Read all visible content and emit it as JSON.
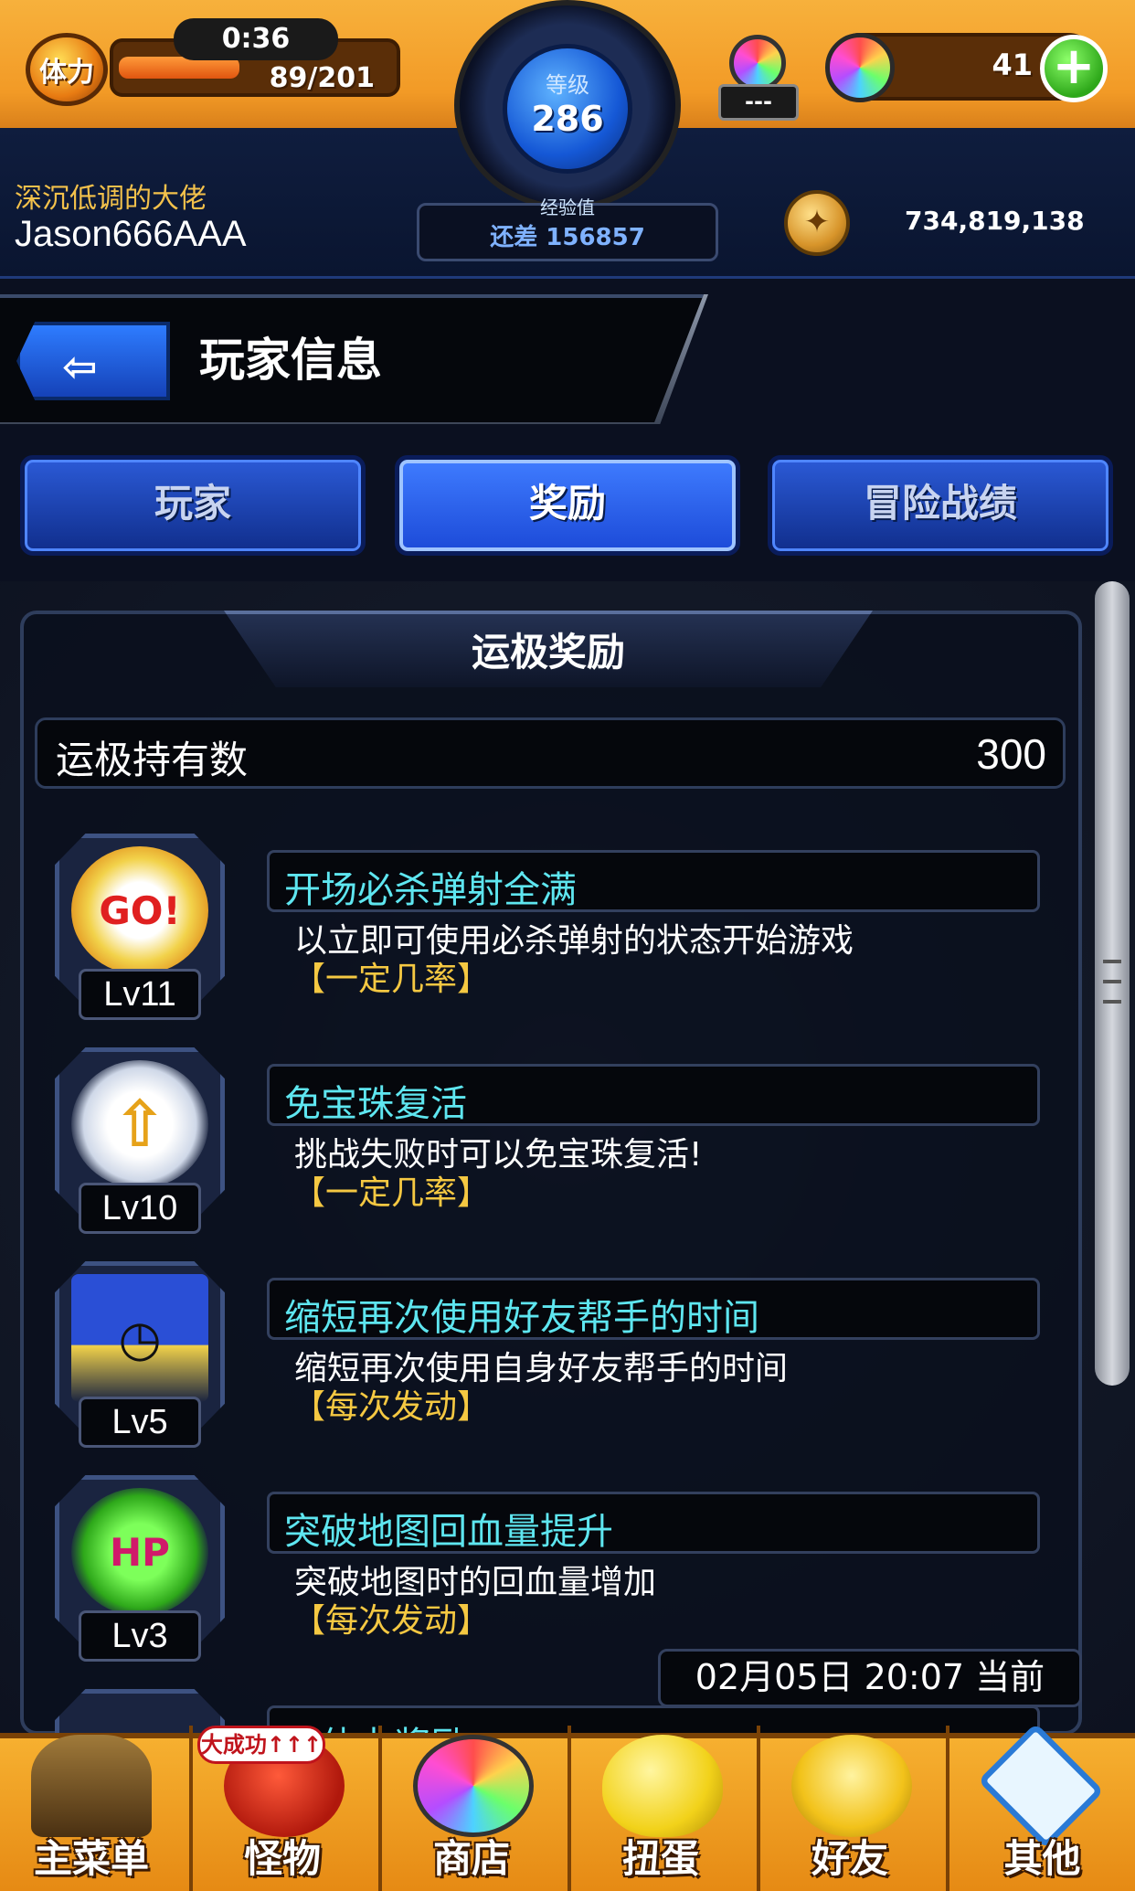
{
  "hud": {
    "stamina_label": "体力",
    "stamina_timer": "0:36",
    "stamina_value": "89/201",
    "stamina_fraction": 0.44,
    "level_label": "等级",
    "level_value": "286",
    "exp_label": "经验值",
    "exp_prefix": "还差",
    "exp_remaining": "156857",
    "gem_cap_count": "---",
    "gem_count": "41",
    "gem_plus": "+",
    "coin_value": "734,819,138"
  },
  "player": {
    "title": "深沉低调的大佬",
    "name": "Jason666AAA"
  },
  "header": {
    "title": "玩家信息",
    "back_icon": "back-arrow-icon"
  },
  "tabs": [
    {
      "label": "玩家",
      "active": false
    },
    {
      "label": "奖励",
      "active": true
    },
    {
      "label": "冒险战绩",
      "active": false
    }
  ],
  "section": {
    "title": "运极奖励",
    "owned_label": "运极持有数",
    "owned_value": "300"
  },
  "rewards": [
    {
      "level": "Lv11",
      "name": "开场必杀弹射全满",
      "desc": "以立即可使用必杀弹射的状态开始游戏",
      "rate": "【一定几率】",
      "icon": "go-burst-icon"
    },
    {
      "level": "Lv10",
      "name": "免宝珠复活",
      "desc": "挑战失败时可以免宝珠复活!",
      "rate": "【一定几率】",
      "icon": "winged-revive-icon"
    },
    {
      "level": "Lv5",
      "name": "缩短再次使用好友帮手的时间",
      "desc": "缩短再次使用自身好友帮手的时间",
      "rate": "【每次发动】",
      "icon": "friend-timer-icon"
    },
    {
      "level": "Lv3",
      "name": "突破地图回血量提升",
      "desc": "突破地图时的回血量增加",
      "rate": "【每次发动】",
      "icon": "hp-up-icon"
    },
    {
      "level": "",
      "name": "满体力奖励",
      "desc": "",
      "rate": "",
      "icon": "partial-icon"
    }
  ],
  "timestamp": "02月05日 20:07 当前",
  "bottom_nav": [
    {
      "label": "主菜单",
      "icon": "gate-icon"
    },
    {
      "label": "怪物",
      "icon": "monster-icon"
    },
    {
      "label": "商店",
      "icon": "rainbow-orb-icon"
    },
    {
      "label": "扭蛋",
      "icon": "egg-icon"
    },
    {
      "label": "好友",
      "icon": "friends-icon"
    },
    {
      "label": "其他",
      "icon": "question-icon"
    }
  ],
  "promo_badge": "大成功↑↑↑",
  "colors": {
    "hud_orange": "#f29a26",
    "tab_blue": "#1c4ad8",
    "reward_name_cyan": "#5ee6f0",
    "rate_yellow": "#f5c842",
    "title_gold": "#f3c14b"
  }
}
